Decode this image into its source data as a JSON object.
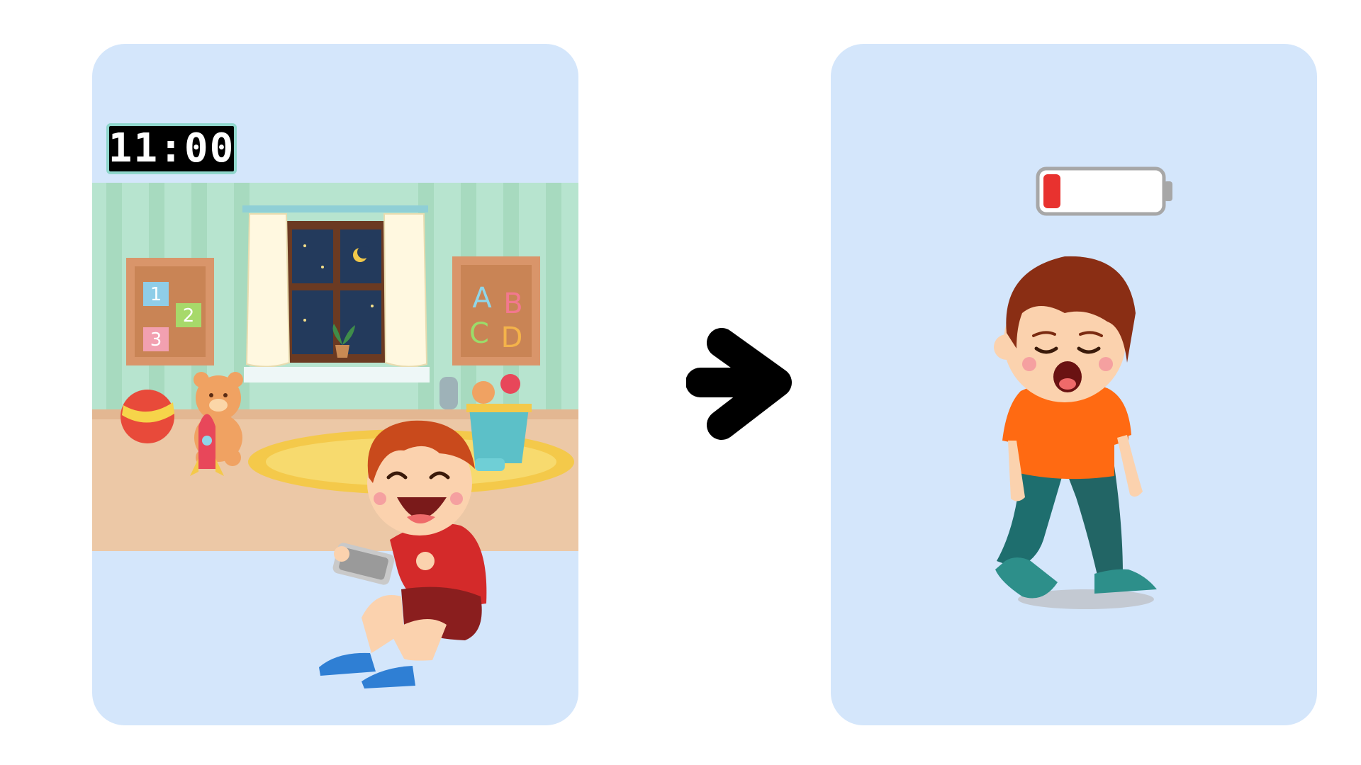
{
  "clock": {
    "time": "11:00"
  },
  "board_left": {
    "numbers": [
      "1",
      "2",
      "3"
    ]
  },
  "board_right": {
    "letters": [
      "A",
      "B",
      "C",
      "D"
    ]
  },
  "battery": {
    "level": 0.15,
    "color": "#e8322f"
  },
  "colors": {
    "card_bg": "#d4e6fb",
    "wall": "#b7e4cf",
    "floor": "#ecc8a6",
    "arrow": "#000000",
    "shirt_left": "#d42a2a",
    "shirt_right": "#ff6a12"
  },
  "icons": [
    "arrow-right-icon",
    "battery-low-icon"
  ]
}
